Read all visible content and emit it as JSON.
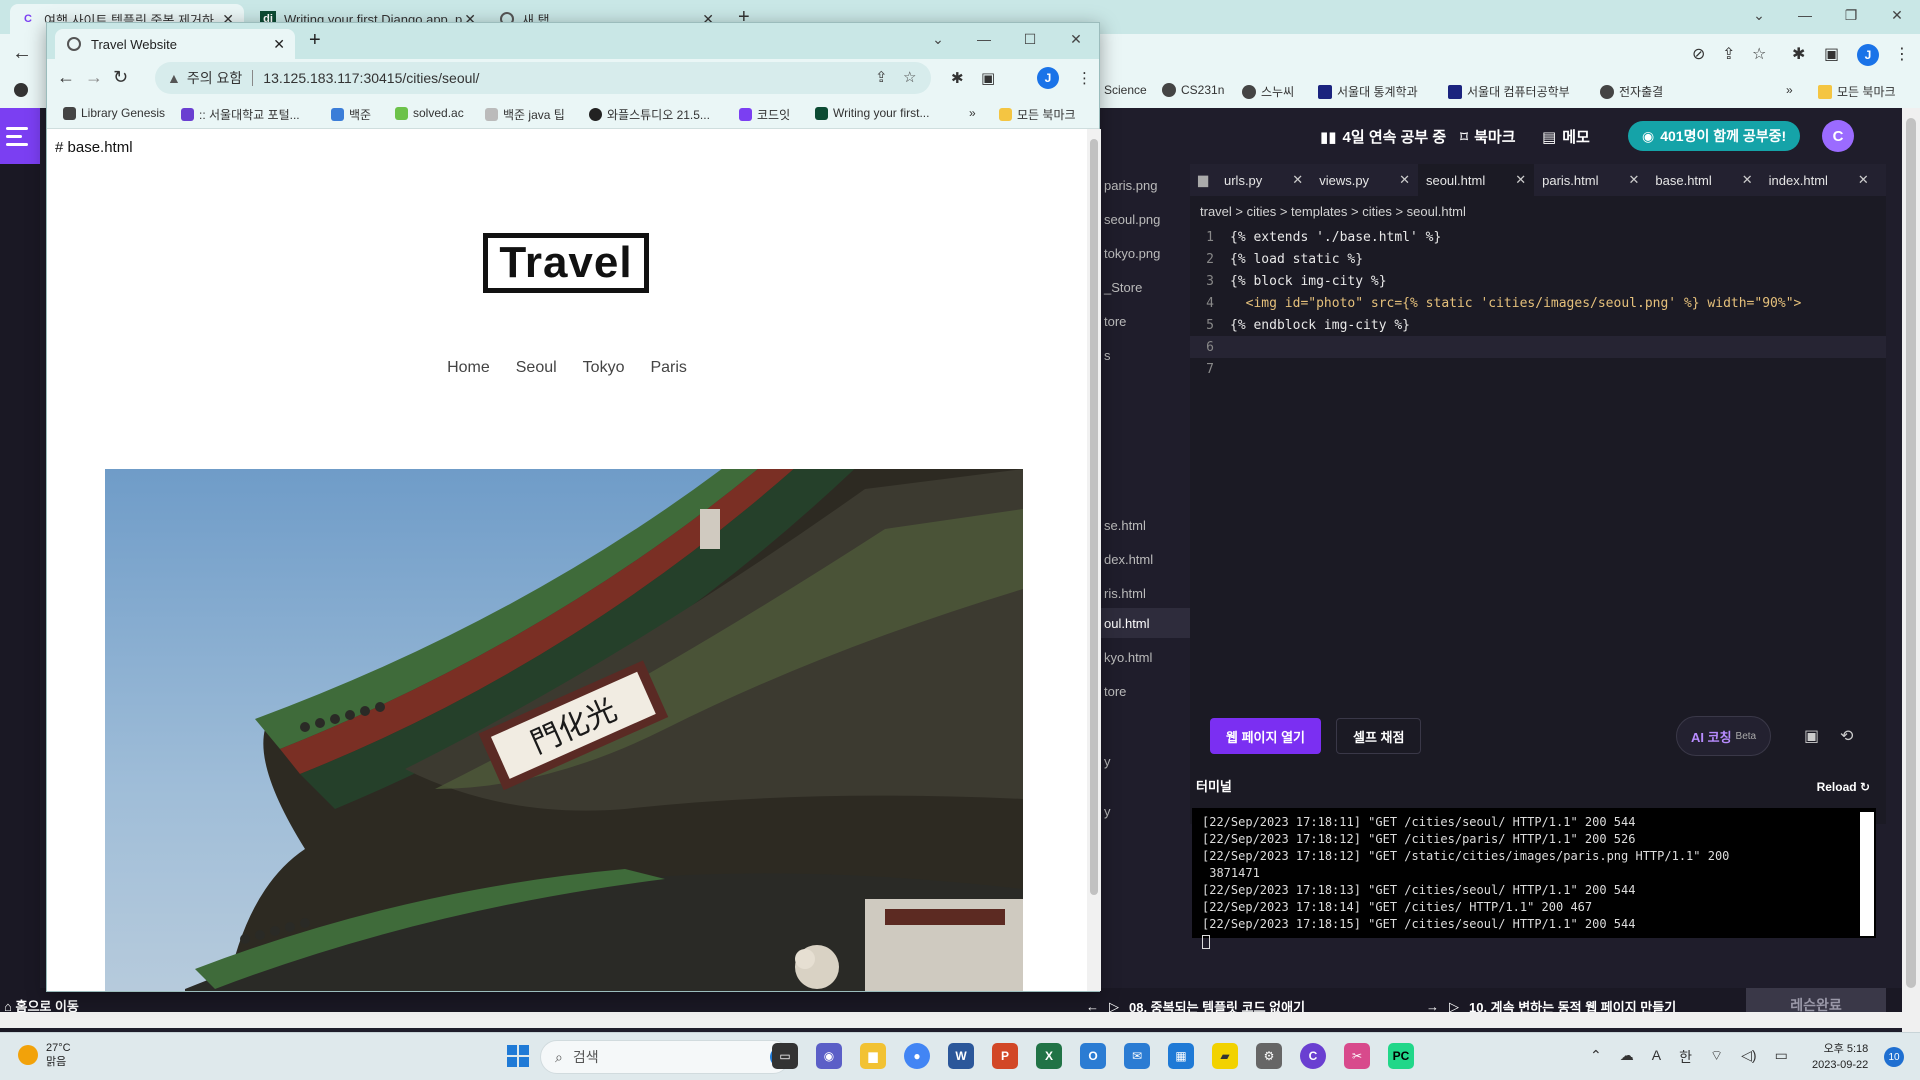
{
  "background_window": {
    "tabs": [
      {
        "label": "여행 사이트 템플릿 중복 제거하",
        "icon": "codeit-icon"
      },
      {
        "label": "Writing your first Django app, p",
        "icon": "django-icon"
      },
      {
        "label": "새 탭",
        "icon": "chrome-icon"
      }
    ],
    "bookmarks": [
      "Science",
      "CS231n",
      "스누씨",
      "서울대 통계학과",
      "서울대 컴퓨터공학부",
      "전자출결",
      "모든 북마크"
    ],
    "avatar_letter": "J"
  },
  "lesson_app": {
    "header": {
      "streak": "4일 연속 공부 중",
      "bookmark": "북마크",
      "memo": "메모",
      "studying_now": "401명이 함께 공부중!",
      "avatar_letter": "C"
    },
    "file_tree": [
      "paris.png",
      "seoul.png",
      "tokyo.png",
      "_Store",
      "tore",
      "s",
      "se.html",
      "dex.html",
      "ris.html",
      "oul.html",
      "kyo.html",
      "tore",
      "y",
      "y"
    ],
    "editor_tabs": [
      {
        "label": "urls.py"
      },
      {
        "label": "views.py"
      },
      {
        "label": "seoul.html",
        "active": true
      },
      {
        "label": "paris.html"
      },
      {
        "label": "base.html"
      },
      {
        "label": "index.html"
      }
    ],
    "breadcrumb": "travel > cities > templates > cities > seoul.html",
    "code_lines": [
      {
        "n": "1",
        "text": "{% extends './base.html' %}"
      },
      {
        "n": "2",
        "text": "{% load static %}"
      },
      {
        "n": "3",
        "text": "{% block img-city %}"
      },
      {
        "n": "4",
        "text": "  <img id=\"photo\" src={% static 'cities/images/seoul.png' %} width=\"90%\">"
      },
      {
        "n": "5",
        "text": "{% endblock img-city %}"
      },
      {
        "n": "6",
        "text": ""
      },
      {
        "n": "7",
        "text": ""
      }
    ],
    "run_bar": {
      "open_web": "웹 페이지 열기",
      "self_grade": "셀프 채점",
      "ai_coach": "AI 코칭",
      "ai_coach_badge": "Beta"
    },
    "terminal": {
      "title": "터미널",
      "reload": "Reload",
      "lines": [
        "[22/Sep/2023 17:18:11] \"GET /cities/seoul/ HTTP/1.1\" 200 544",
        "[22/Sep/2023 17:18:12] \"GET /cities/paris/ HTTP/1.1\" 200 526",
        "[22/Sep/2023 17:18:12] \"GET /static/cities/images/paris.png HTTP/1.1\" 200",
        " 3871471",
        "[22/Sep/2023 17:18:13] \"GET /cities/seoul/ HTTP/1.1\" 200 544",
        "[22/Sep/2023 17:18:14] \"GET /cities/ HTTP/1.1\" 200 467",
        "[22/Sep/2023 17:18:15] \"GET /cities/seoul/ HTTP/1.1\" 200 544"
      ]
    },
    "footer": {
      "home": "홈으로 이동",
      "prev_lesson": "08. 중복되는 템플릿 코드 없애기",
      "next_lesson": "10. 계속 변하는 동적 웹 페이지 만들기",
      "complete": "레슨완료"
    }
  },
  "foreground_window": {
    "tab_title": "Travel Website",
    "security_label": "주의 요함",
    "url": "13.125.183.117:30415/cities/seoul/",
    "avatar_letter": "J",
    "bookmarks": [
      "Library Genesis",
      ":: 서울대학교 포털...",
      "백준",
      "solved.ac",
      "백준 java 팁",
      "와플스튜디오 21.5...",
      "코드잇",
      "Writing your first...",
      "모든 북마크"
    ],
    "page": {
      "heading_text": "# base.html",
      "logo": "Travel",
      "nav": [
        "Home",
        "Seoul",
        "Tokyo",
        "Paris"
      ],
      "image_alt": "Gwanghwamun gate, Seoul",
      "gate_sign": "門化光"
    }
  },
  "taskbar": {
    "weather_temp": "27°C",
    "weather_desc": "맑음",
    "search_placeholder": "검색",
    "ime": "한",
    "ime_alt": "A",
    "time": "오후 5:18",
    "date": "2023-09-22",
    "notifications": "10"
  }
}
